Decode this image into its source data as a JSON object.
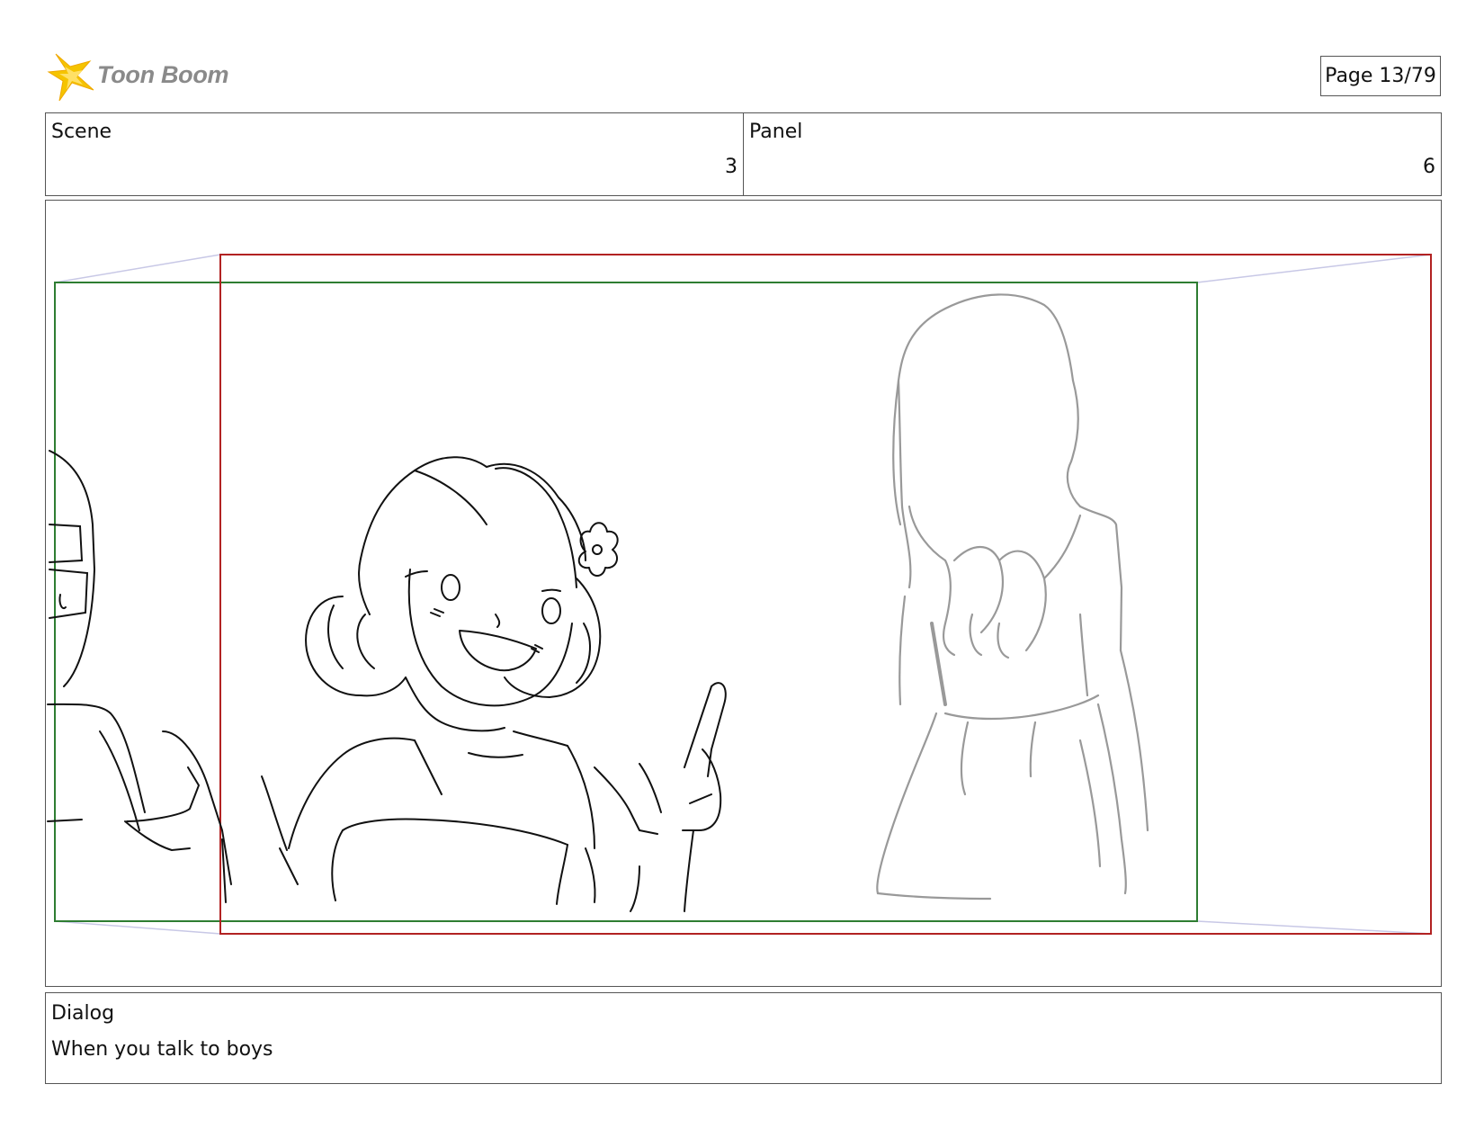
{
  "header": {
    "logo_text": "Toon Boom",
    "page_label": "Page 13/79"
  },
  "info": {
    "scene_label": "Scene",
    "scene_value": "3",
    "panel_label": "Panel",
    "panel_value": "6"
  },
  "dialog": {
    "label": "Dialog",
    "text": "When you talk to boys"
  },
  "colors": {
    "camera_frame_end": "#b22222",
    "camera_frame_start": "#2e7d32",
    "frame_connector": "#c8c8e6",
    "sketch_ink": "#111111",
    "sketch_light": "#999999",
    "logo_star": "#f5c400"
  }
}
